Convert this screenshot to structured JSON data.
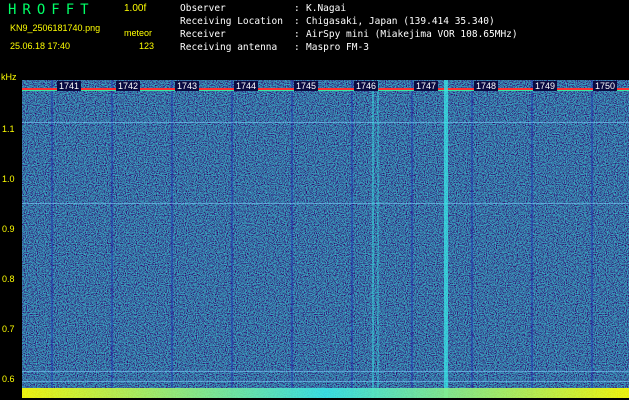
{
  "app": {
    "title": "HROFFT",
    "version": "1.00f",
    "filename": "KN9_2506181740.png",
    "meteor_label": "meteor",
    "datetime": "25.06.18 17:40",
    "count": "123"
  },
  "info": [
    {
      "label": "Observer",
      "sep": ":",
      "value": "K.Nagai"
    },
    {
      "label": "Receiving Location",
      "sep": ":",
      "value": "Chigasaki, Japan (139.414 35.340)"
    },
    {
      "label": "Receiver",
      "sep": ":",
      "value": "AirSpy mini (Miakejima VOR 108.65MHz)"
    },
    {
      "label": "Receiving antenna",
      "sep": ":",
      "value": "Maspro FM-3"
    }
  ],
  "axis": {
    "unit": "kHz",
    "y_ticks": [
      "1.1",
      "1.0",
      "0.9",
      "0.8",
      "0.7",
      "0.6"
    ],
    "time_labels": [
      "1741",
      "1742",
      "1743",
      "1744",
      "1745",
      "1746",
      "1747",
      "1748",
      "1749",
      "1750"
    ]
  },
  "colors": {
    "background": "#000000",
    "accent_yellow": "#ffff00",
    "title_green": "#00ff66",
    "spectro_base": "#0a1a8c",
    "signal_cyan": "#39e6e6"
  }
}
